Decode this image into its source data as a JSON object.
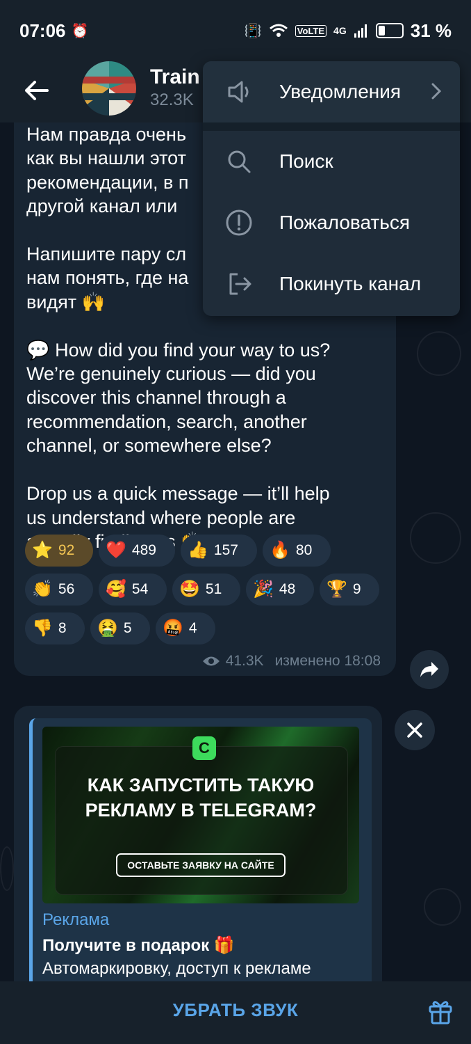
{
  "status_bar": {
    "time": "07:06",
    "network": "4G",
    "volte": "VoLTE",
    "battery_percent": "31 %",
    "battery_level": 0.31
  },
  "header": {
    "channel_title": "Train",
    "subscribers": "32.3K"
  },
  "menu": {
    "items": [
      {
        "label": "Уведомления",
        "icon": "speaker-icon",
        "has_submenu": true
      },
      {
        "label": "Поиск",
        "icon": "search-icon"
      },
      {
        "label": "Пожаловаться",
        "icon": "report-icon"
      },
      {
        "label": "Покинуть канал",
        "icon": "leave-icon"
      }
    ]
  },
  "message": {
    "text": "Нам правда очень\nкак вы нашли этот\nрекомендации, в п\nдругой канал или\n\nНапишите пару сл\nнам понять, где на\nвидят 🙌\n\n💬 How did you find your way to us?\nWe’re genuinely curious — did you\ndiscover this channel through a\nrecommendation, search, another\nchannel, or somewhere else?\n\nDrop us a quick message — it’ll help\nus understand where people are\nactually finding us 🙌",
    "reactions": [
      {
        "emoji": "⭐",
        "count": "92",
        "active": true
      },
      {
        "emoji": "❤️",
        "count": "489"
      },
      {
        "emoji": "👍",
        "count": "157"
      },
      {
        "emoji": "🔥",
        "count": "80"
      },
      {
        "emoji": "👏",
        "count": "56"
      },
      {
        "emoji": "🥰",
        "count": "54"
      },
      {
        "emoji": "🤩",
        "count": "51"
      },
      {
        "emoji": "🎉",
        "count": "48"
      },
      {
        "emoji": "🏆",
        "count": "9"
      },
      {
        "emoji": "👎",
        "count": "8"
      },
      {
        "emoji": "🤮",
        "count": "5"
      },
      {
        "emoji": "🤬",
        "count": "4"
      }
    ],
    "views": "41.3K",
    "edited_time": "изменено 18:08"
  },
  "ad": {
    "image_headline_1": "КАК ЗАПУСТИТЬ ТАКУЮ",
    "image_headline_2": "РЕКЛАМУ В TELEGRAM?",
    "image_cta": "ОСТАВЬТЕ ЗАЯВКУ НА САЙТЕ",
    "logo_letter": "C",
    "label": "Реклама",
    "title": "Получите в подарок 🎁",
    "text": "Автомаркировку, доступ к рекламе"
  },
  "bottom": {
    "mute_label": "УБРАТЬ ЗВУК"
  },
  "colors": {
    "accent": "#5aa5e8",
    "bubble": "#182533",
    "background": "#0e1621",
    "active_reaction": "#5b4a29"
  }
}
